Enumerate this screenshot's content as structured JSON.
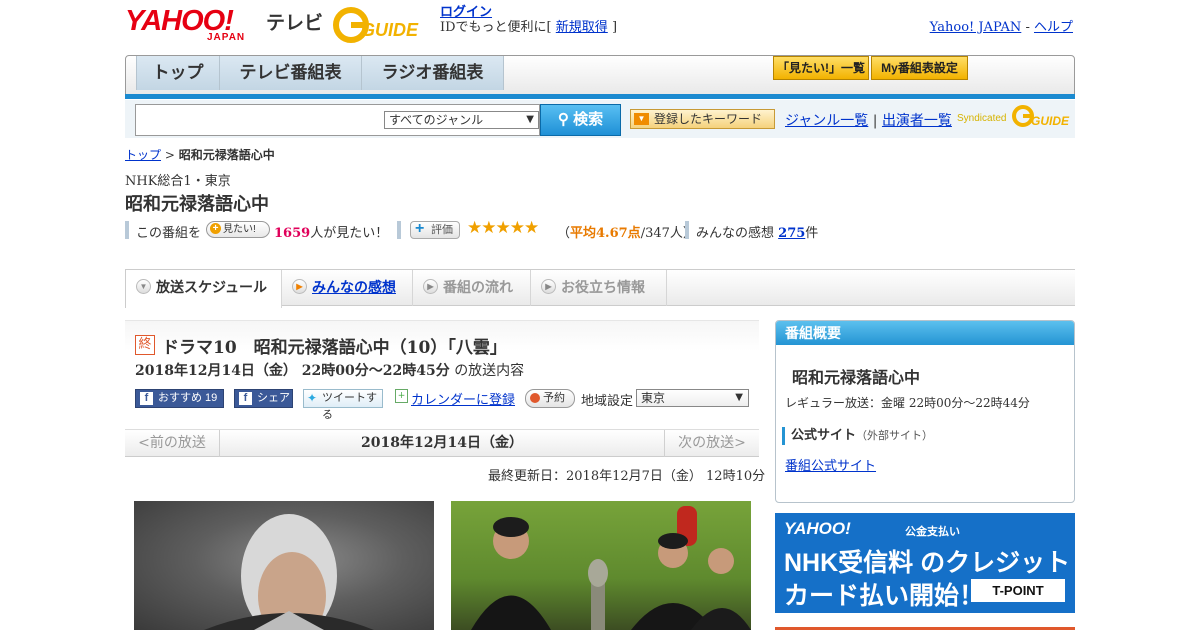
{
  "header": {
    "yahoo_logo": "YAHOO!",
    "yahoo_sub": "JAPAN",
    "tv_label": "テレビ",
    "gguide_logo": "GUIDE",
    "login": "ログイン",
    "login_text": "IDでもっと便利に[",
    "signup": "新規取得",
    "login_text_end": "]",
    "yahoo_japan_link": "Yahoo! JAPAN",
    "dash": "-",
    "help_link": "ヘルプ"
  },
  "nav": {
    "tabs": [
      "トップ",
      "テレビ番組表",
      "ラジオ番組表"
    ],
    "mitai_list": "「見たい!」一覧",
    "my_bangumi": "My番組表設定"
  },
  "search": {
    "genre_selected": "すべてのジャンル",
    "search_button": "検索",
    "keyword_button": "登録したキーワード",
    "genre_list": "ジャンル一覧",
    "sep": "|",
    "performers": "出演者一覧",
    "syndicated": "Syndicated"
  },
  "breadcrumb": {
    "top": "トップ",
    "sep": ">",
    "current": "昭和元禄落語心中"
  },
  "program": {
    "channel": "NHK総合1・東京",
    "title": "昭和元禄落語心中"
  },
  "stats": {
    "kono": "この番組を",
    "mitai_btn": "見たい!",
    "mitai_count": "1659",
    "mitai_suffix": "人が見たい！",
    "hyoka_btn": "評価",
    "stars": "★★★★★",
    "avg_open": "（",
    "avg": "平均4.67点",
    "avg_count": "/347人）",
    "kanso_label": "みんなの感想",
    "kanso_count": "275",
    "kanso_suffix": "件"
  },
  "subtabs": [
    "放送スケジュール",
    "みんなの感想",
    "番組の流れ",
    "お役立ち情報"
  ],
  "broadcast": {
    "end_badge": "終",
    "title": "ドラマ10　昭和元禄落語心中（10）「八雲」",
    "time": "2018年12月14日（金） 22時00分～22時45分",
    "time_suffix": "の放送内容",
    "fb_reco": "おすすめ 19",
    "fb_share": "シェア",
    "tweet": "ツイートする",
    "calendar": "カレンダーに登録",
    "yoyaku": "予約",
    "region_label": "地域設定",
    "region": "東京"
  },
  "datenav": {
    "prev": "<前の放送",
    "current": "2018年12月14日（金）",
    "next": "次の放送>"
  },
  "updated": "最終更新日：2018年12月7日（金） 12時10分",
  "overview": {
    "header": "番組概要",
    "title": "昭和元禄落語心中",
    "regular": "レギュラー放送：金曜 22時00分～22時44分",
    "official": "公式サイト",
    "external": "（外部サイト）",
    "official_link": "番組公式サイト"
  },
  "ad": {
    "brand": "YAHOO!",
    "brand_sub": "公金支払い",
    "line1": "NHK受信料 のクレジット",
    "line2": "カード払い開始！",
    "tpoint": "T-POINT"
  }
}
